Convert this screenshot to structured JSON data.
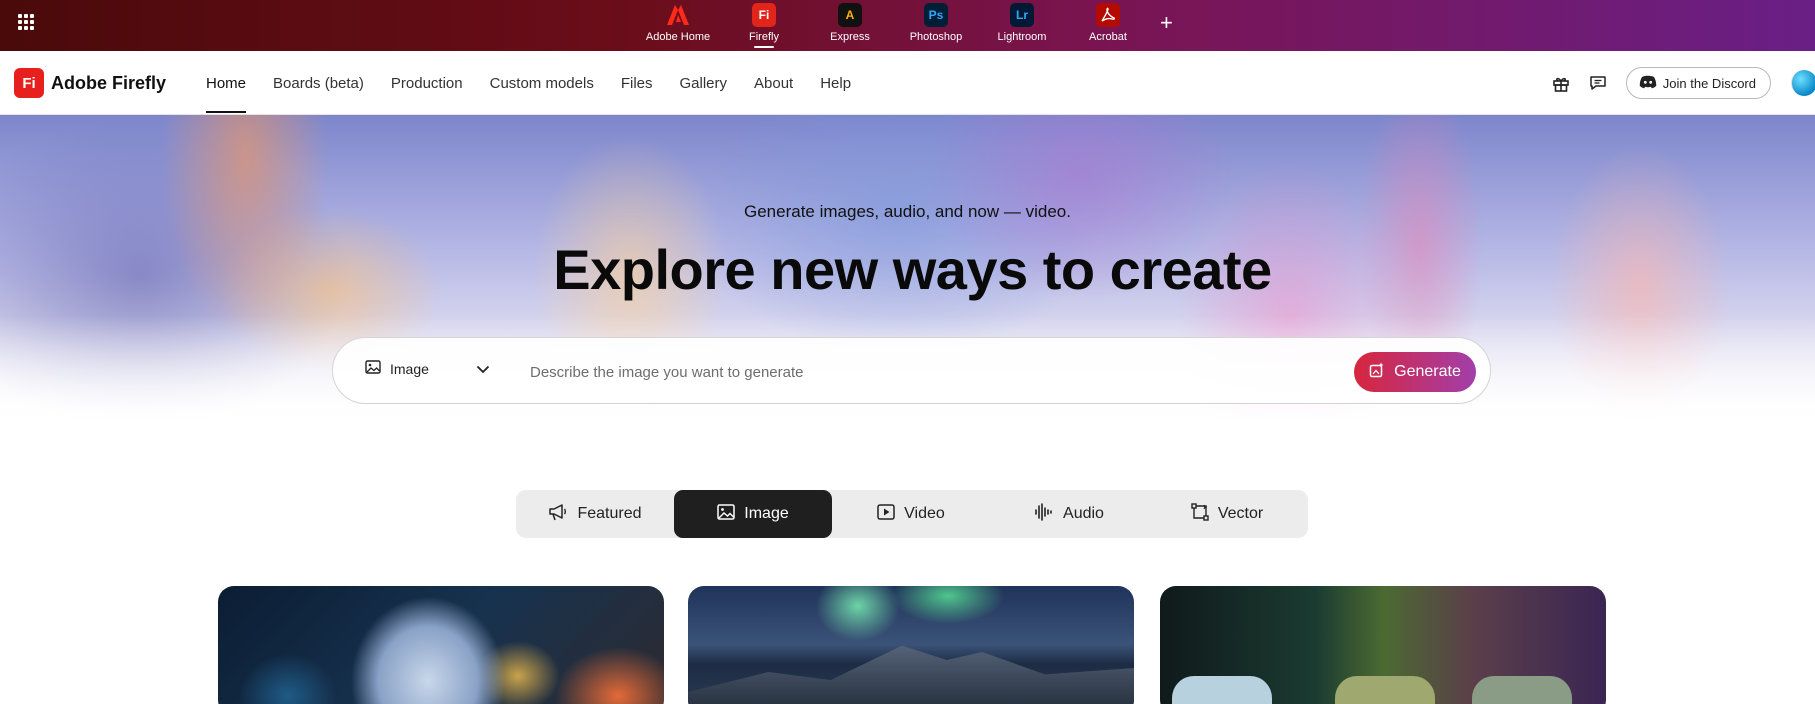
{
  "appbar": {
    "apps": [
      {
        "label": "Adobe Home",
        "icon": "adobe-logo-icon",
        "badge": "A",
        "color": "#e1251b",
        "active": false
      },
      {
        "label": "Firefly",
        "icon": "firefly-icon",
        "badge": "Fi",
        "color": "#e1251b",
        "active": true
      },
      {
        "label": "Express",
        "icon": "express-icon",
        "badge": "A",
        "color": "#000000",
        "active": false
      },
      {
        "label": "Photoshop",
        "icon": "photoshop-icon",
        "badge": "Ps",
        "color": "#001e36",
        "active": false
      },
      {
        "label": "Lightroom",
        "icon": "lightroom-icon",
        "badge": "Lr",
        "color": "#001a36",
        "active": false
      },
      {
        "label": "Acrobat",
        "icon": "acrobat-icon",
        "badge": "A",
        "color": "#b30b00",
        "active": false
      }
    ],
    "add_label": "+"
  },
  "nav": {
    "brand": "Adobe Firefly",
    "brand_mark": "Fi",
    "links": [
      "Home",
      "Boards (beta)",
      "Production",
      "Custom models",
      "Files",
      "Gallery",
      "About",
      "Help"
    ],
    "active": "Home",
    "discord_label": "Join the Discord"
  },
  "hero": {
    "subtitle": "Generate images, audio, and now — video.",
    "title": "Explore new ways to create"
  },
  "prompt": {
    "type_value": "Image",
    "placeholder": "Describe the image you want to generate",
    "value": "",
    "generate_label": "Generate"
  },
  "tabs": [
    {
      "label": "Featured",
      "icon": "megaphone-icon"
    },
    {
      "label": "Image",
      "icon": "image-icon"
    },
    {
      "label": "Video",
      "icon": "video-icon"
    },
    {
      "label": "Audio",
      "icon": "audio-wave-icon"
    },
    {
      "label": "Vector",
      "icon": "vector-icon"
    }
  ],
  "active_tab": "Image",
  "colors": {
    "accent": "#e1251b",
    "generate_gradient_start": "#d7263d",
    "generate_gradient_end": "#a23eaa",
    "active_tab": "#1f1f1f"
  }
}
